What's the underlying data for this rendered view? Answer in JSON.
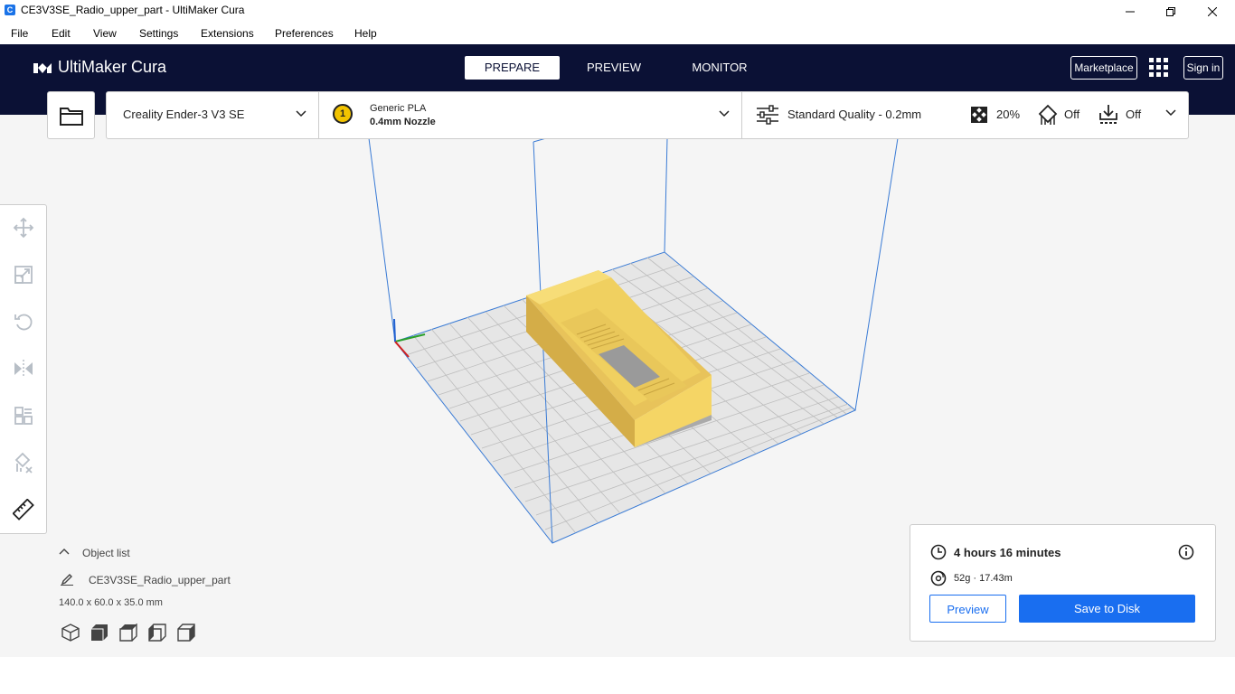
{
  "window": {
    "title": "CE3V3SE_Radio_upper_part - UltiMaker Cura"
  },
  "menu": [
    "File",
    "Edit",
    "View",
    "Settings",
    "Extensions",
    "Preferences",
    "Help"
  ],
  "header": {
    "logo": "UltiMaker Cura",
    "tabs": [
      "PREPARE",
      "PREVIEW",
      "MONITOR"
    ],
    "active_tab": "PREPARE",
    "marketplace": "Marketplace",
    "signin": "Sign in"
  },
  "stage": {
    "printer": "Creality Ender-3 V3 SE",
    "extruder_number": "1",
    "material": "Generic PLA",
    "nozzle": "0.4mm Nozzle",
    "quality": "Standard Quality - 0.2mm",
    "infill": "20%",
    "support": "Off",
    "adhesion": "Off"
  },
  "objects": {
    "header": "Object list",
    "name": "CE3V3SE_Radio_upper_part",
    "dimensions": "140.0 x 60.0 x 35.0 mm"
  },
  "estimate": {
    "time": "4 hours 16 minutes",
    "material": "52g · 17.43m",
    "preview_button": "Preview",
    "save_button": "Save to Disk"
  },
  "colors": {
    "header_bg": "#0b1135",
    "accent": "#196ef0",
    "model": "#f5d565"
  }
}
